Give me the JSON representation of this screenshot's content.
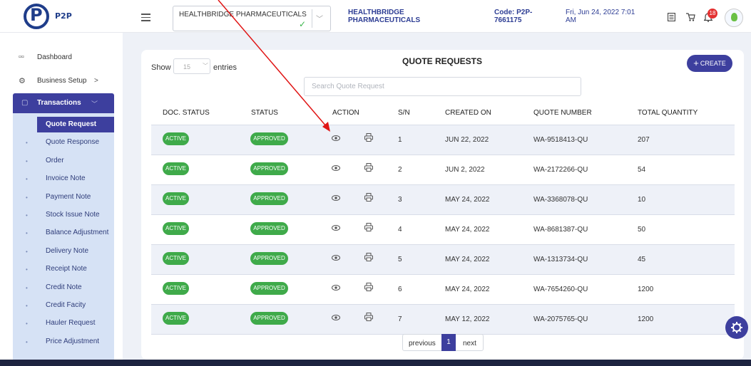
{
  "header": {
    "logo_text": "P2P",
    "company_select_value": "HEALTHBRIDGE PHARMACEUTICALS",
    "company_name": "HEALTHBRIDGE PHARMACEUTICALS",
    "code": "Code: P2P-7661175",
    "datetime": "Fri, Jun 24, 2022 7:01 AM",
    "notification_count": "18",
    "icons": [
      "menu-icon",
      "document-icon",
      "cart-icon",
      "bell-icon",
      "avatar"
    ]
  },
  "sidebar": {
    "dashboard": "Dashboard",
    "business_setup": "Business Setup",
    "business_setup_chevron": ">",
    "transactions": "Transactions",
    "submenu": [
      "Quote Request",
      "Quote Response",
      "Order",
      "Invoice Note",
      "Payment Note",
      "Stock Issue Note",
      "Balance Adjustment",
      "Delivery Note",
      "Receipt Note",
      "Credit Note",
      "Credit Facity",
      "Hauler Request",
      "Price Adjustment"
    ],
    "active_index": 0
  },
  "main": {
    "show_label": "Show",
    "page_size": "15",
    "entries_label": "entries",
    "title": "QUOTE REQUESTS",
    "create_label": "CREATE",
    "search_placeholder": "Search Quote Request",
    "columns": [
      "DOC. STATUS",
      "STATUS",
      "ACTION",
      "S/N",
      "CREATED ON",
      "QUOTE NUMBER",
      "TOTAL QUANTITY"
    ],
    "rows": [
      {
        "doc_status": "ACTIVE",
        "status": "APPROVED",
        "sn": "1",
        "created_on": "JUN 22, 2022",
        "quote_number": "WA-9518413-QU",
        "total_quantity": "207"
      },
      {
        "doc_status": "ACTIVE",
        "status": "APPROVED",
        "sn": "2",
        "created_on": "JUN 2, 2022",
        "quote_number": "WA-2172266-QU",
        "total_quantity": "54"
      },
      {
        "doc_status": "ACTIVE",
        "status": "APPROVED",
        "sn": "3",
        "created_on": "MAY 24, 2022",
        "quote_number": "WA-3368078-QU",
        "total_quantity": "10"
      },
      {
        "doc_status": "ACTIVE",
        "status": "APPROVED",
        "sn": "4",
        "created_on": "MAY 24, 2022",
        "quote_number": "WA-8681387-QU",
        "total_quantity": "50"
      },
      {
        "doc_status": "ACTIVE",
        "status": "APPROVED",
        "sn": "5",
        "created_on": "MAY 24, 2022",
        "quote_number": "WA-1313734-QU",
        "total_quantity": "45"
      },
      {
        "doc_status": "ACTIVE",
        "status": "APPROVED",
        "sn": "6",
        "created_on": "MAY 24, 2022",
        "quote_number": "WA-7654260-QU",
        "total_quantity": "1200"
      },
      {
        "doc_status": "ACTIVE",
        "status": "APPROVED",
        "sn": "7",
        "created_on": "MAY 12, 2022",
        "quote_number": "WA-2075765-QU",
        "total_quantity": "1200"
      }
    ],
    "pagination": {
      "previous": "previous",
      "current": "1",
      "next": "next"
    }
  },
  "colors": {
    "primary": "#3d3f9e",
    "status_green": "#3faa4a",
    "submenu_bg": "#d6e2f5",
    "annotation_arrow": "#e01515"
  }
}
